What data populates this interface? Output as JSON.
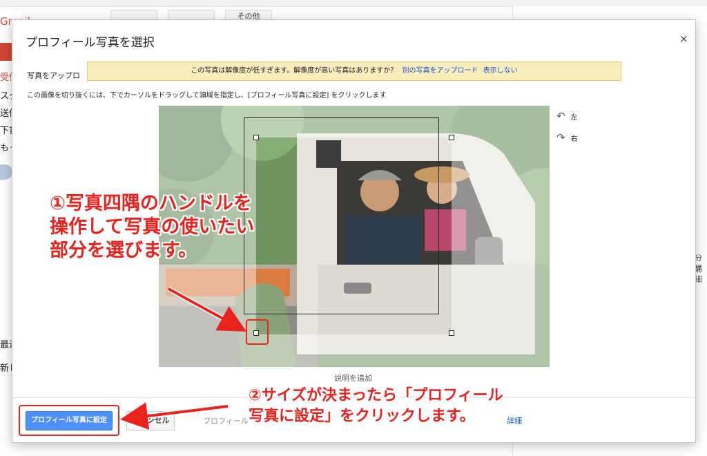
{
  "background": {
    "logo": "Gmail",
    "toolbar_buttons": [
      "",
      "",
      "その他"
    ],
    "side_items": [
      "受信",
      "スタ",
      "送信",
      "下書",
      "もっ"
    ],
    "side_lower": [
      "最近",
      "新し"
    ],
    "right_texts": [
      "分前",
      "詳細"
    ]
  },
  "dialog": {
    "title": "プロフィール写真を選択",
    "close": "×",
    "upload_label": "写真をアップロ",
    "banner": {
      "message": "この写真は解像度が低すぎます。解像度が高い写真はありますか？",
      "upload_link": "別の写真をアップロード",
      "dismiss_link": "表示しない"
    },
    "instruction": "この画像を切り抜くには、下でカーソルをドラッグして領域を指定し、[プロフィール写真に設定] をクリックします",
    "rotate_left": "左",
    "rotate_right": "右",
    "caption": "説明を追加",
    "primary_button": "プロフィール写真に設定",
    "cancel_button": "キャンセル",
    "footer_note": "プロフィール",
    "detail_link": "詳細"
  },
  "annotations": {
    "step1": "①写真四隅のハンドルを操作して写真の使いたい部分を選びます。",
    "step2": "②サイズが決まったら「プロフィール写真に設定」をクリックします。"
  },
  "colors": {
    "accent": "#4d90fe",
    "banner_bg": "#f9edbe",
    "annotation_red": "#e8231e",
    "link": "#1155cc"
  },
  "icons": [
    "close-icon",
    "rotate-left-icon",
    "rotate-right-icon",
    "arrow-icon"
  ]
}
